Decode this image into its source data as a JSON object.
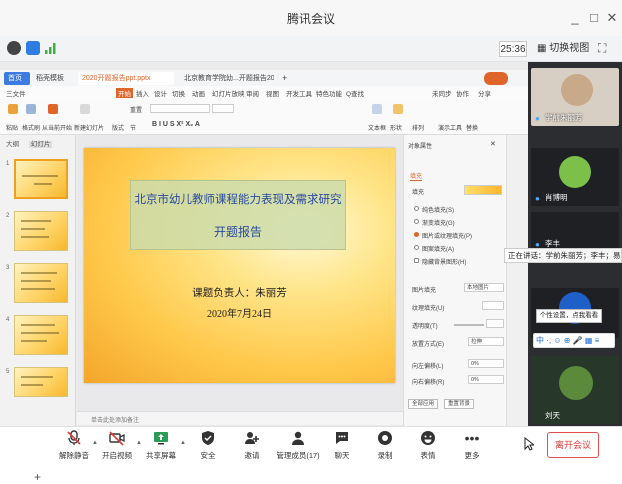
{
  "window": {
    "title": "腾讯会议",
    "controls": [
      "_",
      "□",
      "✕"
    ]
  },
  "status": {
    "timer": "25:36",
    "switch_view": "切换视图"
  },
  "wps": {
    "tabs": [
      "首页",
      "稻壳模板",
      "2020开题报告ppt.pptx",
      "北京教育学院幼...开题报告2020"
    ],
    "new_tab": "+",
    "menu": [
      "三文件",
      "开始",
      "插入",
      "设计",
      "切换",
      "动画",
      "幻灯片放映",
      "审阅",
      "视图",
      "开发工具",
      "特色功能",
      "Q查找"
    ],
    "menu_right": [
      "未同步",
      "协作",
      "分享"
    ],
    "toolbar": [
      "粘贴",
      "格式刷",
      "从当前开始",
      "新建幻灯片",
      "版式",
      "节",
      "重置",
      "文本框",
      "形状",
      "排列",
      "演示工具",
      "替换"
    ]
  },
  "thumbnails": {
    "tabs": [
      "大纲",
      "幻灯片"
    ],
    "numbers": [
      "1",
      "2",
      "3",
      "4",
      "5"
    ],
    "add": "+"
  },
  "slide": {
    "title": "北京市幼儿教师课程能力表现及需求研究",
    "subtitle": "开题报告",
    "leader": "课题负责人：朱丽芳",
    "date": "2020年7月24日",
    "notes_placeholder": "单击此处添加备注"
  },
  "properties": {
    "header": "对象属性",
    "tab": "填充",
    "section": "填充",
    "options": [
      "纯色填充(S)",
      "渐变填充(G)",
      "图片或纹理填充(P)",
      "图案填充(A)",
      "隐藏背景图形(H)"
    ],
    "selected_option": 2,
    "fields": [
      {
        "label": "图片填充",
        "value": "本地图片"
      },
      {
        "label": "纹理填充(U)",
        "value": ""
      },
      {
        "label": "透明度(T)",
        "value": ""
      },
      {
        "label": "放置方式(E)",
        "value": "拉伸"
      },
      {
        "label": "向左偏移(L)",
        "value": "0%"
      },
      {
        "label": "向右偏移(R)",
        "value": "0%"
      }
    ],
    "buttons": [
      "全部应用",
      "重置背景"
    ]
  },
  "participants": [
    {
      "name": "学前朱丽芳",
      "avatar_color": "#c8a98a"
    },
    {
      "name": "肖博明",
      "avatar_color": "#7cc04a"
    },
    {
      "name": "李丰",
      "avatar_color": "#3a6ea5"
    },
    {
      "name": "",
      "avatar_color": "#1f5fc8"
    },
    {
      "name": "",
      "avatar_color": "#5a8a3a"
    },
    {
      "name": "刘天",
      "avatar_color": "#6b7a55"
    }
  ],
  "speaking": "正在讲话：学前朱丽芳；李丰；易...",
  "tooltip": "个性设置，点我看看",
  "ime": "中 ·, ☺ ⊕ 🎤 ▦ ≡",
  "bottom": {
    "items": [
      "解除静音",
      "开启视频",
      "共享屏幕",
      "安全",
      "邀请",
      "管理成员(17)",
      "聊天",
      "录制",
      "表情",
      "更多"
    ],
    "icons": [
      "mic-muted-icon",
      "camera-off-icon",
      "share-screen-icon",
      "shield-icon",
      "invite-icon",
      "members-icon",
      "chat-icon",
      "record-icon",
      "emoji-icon",
      "more-icon"
    ],
    "leave": "离开会议"
  },
  "colors": {
    "accent": "#e0652b",
    "slide_text": "#2b4aa0",
    "leave": "#e03a3a",
    "sidebar_bg": "#2b2d31"
  }
}
